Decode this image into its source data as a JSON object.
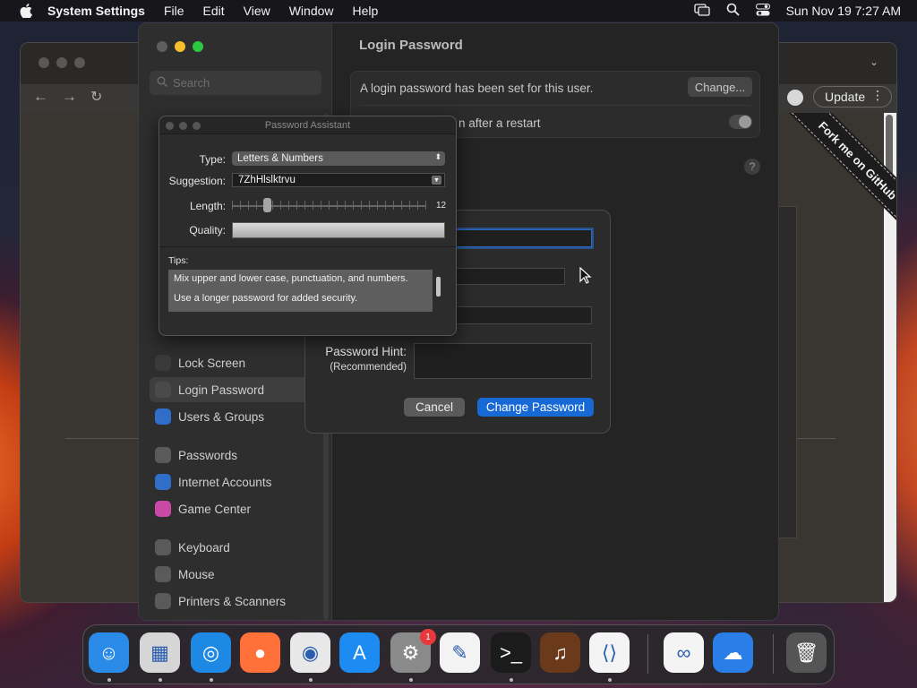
{
  "menubar": {
    "app_name": "System Settings",
    "menus": [
      "File",
      "Edit",
      "View",
      "Window",
      "Help"
    ],
    "clock": "Sun Nov 19  7:27 AM"
  },
  "browser": {
    "update_label": "Update",
    "ribbon_text": "Fork me on GitHub"
  },
  "settings": {
    "search_placeholder": "Search",
    "detail_title": "Login Password",
    "password_set_text": "A login password has been set for this user.",
    "change_label": "Change...",
    "restart_row_text": "n after a restart",
    "help_label": "?",
    "sidebar": [
      {
        "label": "Lock Screen",
        "icon": "lock-icon",
        "color": "#3a3a3a"
      },
      {
        "label": "Login Password",
        "icon": "login-password-icon",
        "color": "#4a4a4a",
        "active": true
      },
      {
        "label": "Users & Groups",
        "icon": "users-icon",
        "color": "#2f6fc9"
      },
      {
        "label": "Passwords",
        "icon": "key-icon",
        "color": "#5a5a5a"
      },
      {
        "label": "Internet Accounts",
        "icon": "at-icon",
        "color": "#2f6fc9"
      },
      {
        "label": "Game Center",
        "icon": "game-center-icon",
        "color": "#c84aa6"
      },
      {
        "label": "Keyboard",
        "icon": "keyboard-icon",
        "color": "#5a5a5a"
      },
      {
        "label": "Mouse",
        "icon": "mouse-icon",
        "color": "#5a5a5a"
      },
      {
        "label": "Printers & Scanners",
        "icon": "printer-icon",
        "color": "#5a5a5a"
      }
    ]
  },
  "sheet": {
    "hint_label": "Password Hint:",
    "hint_sub": "(Recommended)",
    "cancel_label": "Cancel",
    "change_password_label": "Change Password"
  },
  "assistant": {
    "title": "Password Assistant",
    "type_label": "Type:",
    "type_value": "Letters & Numbers",
    "suggestion_label": "Suggestion:",
    "suggestion_value": "7ZhHlslktrvu",
    "length_label": "Length:",
    "length_value": "12",
    "length_fraction": 0.18,
    "quality_label": "Quality:",
    "quality_fraction": 1.0,
    "tips_label": "Tips:",
    "tips": [
      "Mix upper and lower case, punctuation, and numbers.",
      "Use a longer password for added security."
    ]
  },
  "dock": {
    "apps": [
      {
        "name": "finder-icon",
        "color": "#2a8ae8",
        "glyph": "☺"
      },
      {
        "name": "launchpad-icon",
        "color": "#d6d6d6",
        "glyph": "▦"
      },
      {
        "name": "safari-icon",
        "color": "#1e88e5",
        "glyph": "◎"
      },
      {
        "name": "firefox-icon",
        "color": "#ff7139",
        "glyph": "●"
      },
      {
        "name": "chrome-icon",
        "color": "#e8e8e8",
        "glyph": "◉"
      },
      {
        "name": "app-store-icon",
        "color": "#1c8cf3",
        "glyph": "A"
      },
      {
        "name": "system-settings-icon",
        "color": "#8a8a8a",
        "glyph": "⚙"
      },
      {
        "name": "textedit-icon",
        "color": "#f3f3f3",
        "glyph": "✎"
      },
      {
        "name": "terminal-icon",
        "color": "#1b1b1b",
        "glyph": ">_"
      },
      {
        "name": "garageband-icon",
        "color": "#6a3a1a",
        "glyph": "♫"
      },
      {
        "name": "vscode-icon",
        "color": "#f4f4f4",
        "glyph": "⟨⟩"
      },
      {
        "name": "visual-studio-icon",
        "color": "#f4f4f4",
        "glyph": "∞"
      },
      {
        "name": "weather-icon",
        "color": "#2a7ee8",
        "glyph": "☁"
      },
      {
        "name": "trash-icon",
        "color": "#555555",
        "glyph": "🗑"
      }
    ],
    "settings_badge": "1"
  }
}
